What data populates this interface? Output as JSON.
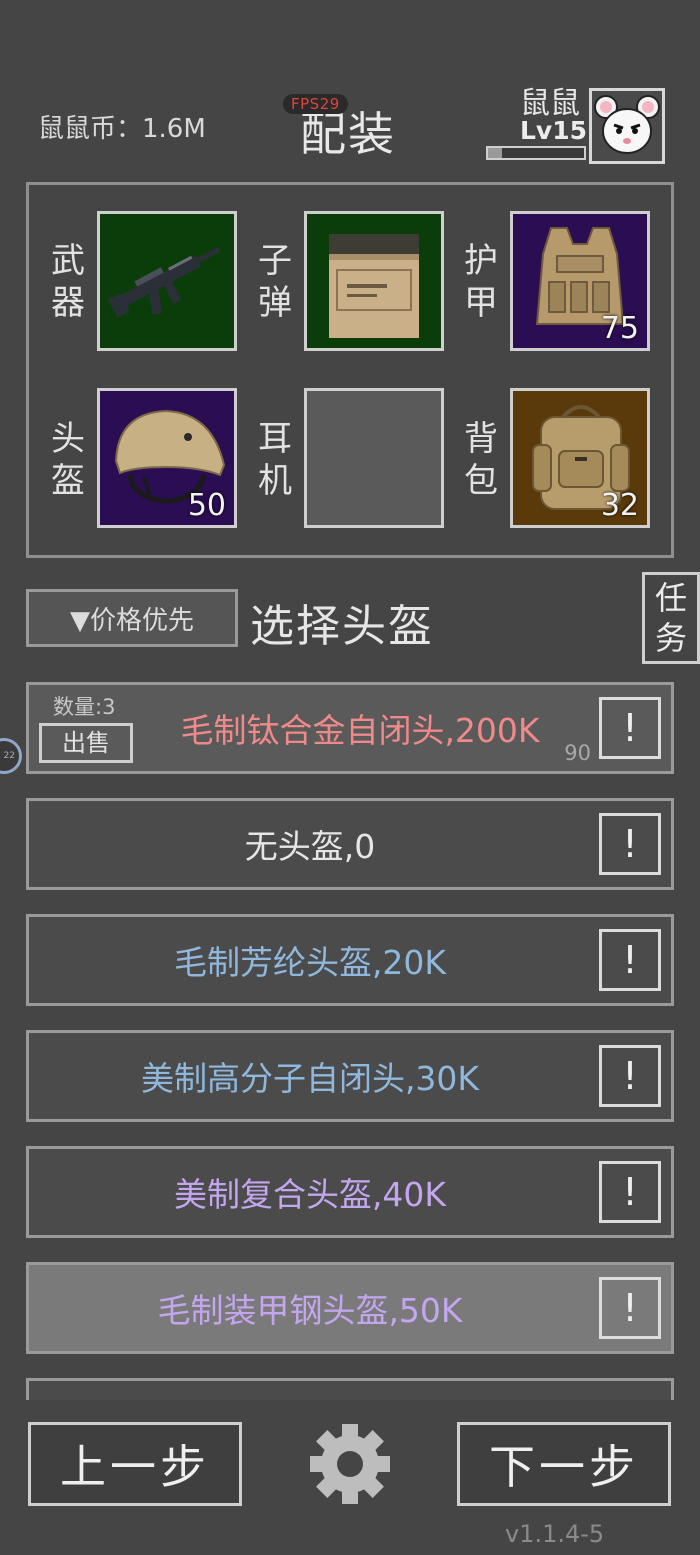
{
  "header": {
    "currency_text": "鼠鼠币：1.6M",
    "fps_text": "FPS29",
    "title": "配装",
    "player_name": "鼠鼠",
    "player_level": "Lv15"
  },
  "colors": {
    "weapon_slot_bg": "#0b3d0b",
    "ammo_slot_bg": "#0b3d0b",
    "armor_slot_bg": "#2a0d52",
    "helmet_slot_bg": "#2a0d52",
    "backpack_slot_bg": "#5a3a0a",
    "empty_slot_bg": "#5a5a5a",
    "red_item": "#f08a8a",
    "white_item": "#e6e6e6",
    "blue_item": "#8fb8dc",
    "purple_item": "#c3a6ee"
  },
  "equipment": {
    "weapon": {
      "label_line1": "武",
      "label_line2": "器",
      "icon": "rifle-icon"
    },
    "ammo": {
      "label_line1": "子",
      "label_line2": "弹",
      "icon": "ammo-box-icon"
    },
    "armor": {
      "label_line1": "护",
      "label_line2": "甲",
      "icon": "body-armor-icon",
      "count": "75"
    },
    "helmet": {
      "label_line1": "头",
      "label_line2": "盔",
      "icon": "helmet-icon",
      "count": "50"
    },
    "earphones": {
      "label_line1": "耳",
      "label_line2": "机",
      "icon": ""
    },
    "backpack": {
      "label_line1": "背",
      "label_line2": "包",
      "icon": "backpack-icon",
      "count": "32"
    }
  },
  "sort": {
    "label": "▼价格优先"
  },
  "select_title": "选择头盔",
  "task_button": {
    "line1": "任",
    "line2": "务"
  },
  "side_indicator": "22",
  "items": [
    {
      "name": "毛制钛合金自闭头,200K",
      "color": "#f08a8a",
      "qty_label": "数量:3",
      "sell_label": "出售",
      "durability": "90",
      "info_label": "!"
    },
    {
      "name": "无头盔,0",
      "color": "#e6e6e6",
      "info_label": "!"
    },
    {
      "name": "毛制芳纶头盔,20K",
      "color": "#8fb8dc",
      "info_label": "!"
    },
    {
      "name": "美制高分子自闭头,30K",
      "color": "#8fb8dc",
      "info_label": "!"
    },
    {
      "name": "美制复合头盔,40K",
      "color": "#c3a6ee",
      "info_label": "!"
    },
    {
      "name": "毛制装甲钢头盔,50K",
      "color": "#c3a6ee",
      "info_label": "!"
    }
  ],
  "bottom": {
    "prev_label": "上一步",
    "next_label": "下一步",
    "settings_icon": "gear-icon",
    "version": "v1.1.4-5"
  }
}
